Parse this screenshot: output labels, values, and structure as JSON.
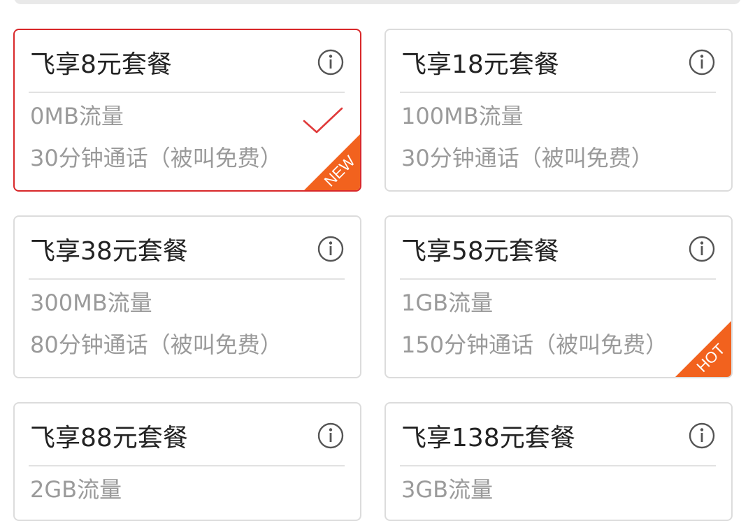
{
  "plans": [
    {
      "title": "飞享8元套餐",
      "data": "0MB流量",
      "calls": "30分钟通话（被叫免费）",
      "selected": true,
      "badge": "NEW"
    },
    {
      "title": "飞享18元套餐",
      "data": "100MB流量",
      "calls": "30分钟通话（被叫免费）",
      "selected": false,
      "badge": ""
    },
    {
      "title": "飞享38元套餐",
      "data": "300MB流量",
      "calls": "80分钟通话（被叫免费）",
      "selected": false,
      "badge": ""
    },
    {
      "title": "飞享58元套餐",
      "data": "1GB流量",
      "calls": "150分钟通话（被叫免费）",
      "selected": false,
      "badge": "HOT"
    },
    {
      "title": "飞享88元套餐",
      "data": "2GB流量",
      "calls": "",
      "selected": false,
      "badge": ""
    },
    {
      "title": "飞享138元套餐",
      "data": "3GB流量",
      "calls": "",
      "selected": false,
      "badge": ""
    }
  ],
  "colors": {
    "selected_border": "#d8282a",
    "badge": "#f2621e",
    "check": "#e03a3a"
  },
  "icons": {
    "info": "info-icon",
    "check": "check-icon",
    "badge": "corner-badge"
  }
}
